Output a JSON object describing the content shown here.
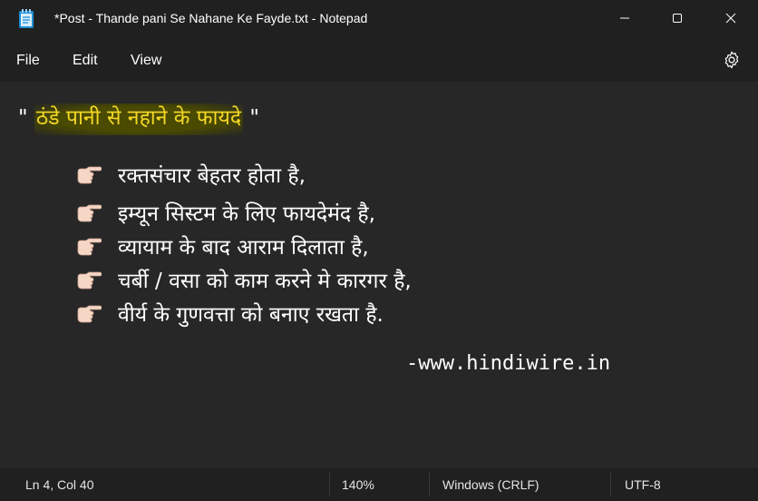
{
  "window": {
    "title": "*Post - Thande pani Se Nahane Ke Fayde.txt - Notepad"
  },
  "menu": {
    "file": "File",
    "edit": "Edit",
    "view": "View"
  },
  "document": {
    "quote_open": "\"",
    "heading": "ठंडे पानी से नहाने के फायदे",
    "quote_close": "\"",
    "bullets": [
      "रक्तसंचार बेहतर होता है,",
      "इम्यून सिस्टम के लिए फायदेमंद है,",
      "व्यायाम के बाद आराम दिलाता है,",
      "चर्बी /  वसा को काम करने मे कारगर है,",
      "वीर्य के गुणवत्ता को बनाए रखता है."
    ],
    "credit": "-www.hindiwire.in"
  },
  "status": {
    "position": "Ln 4, Col 40",
    "zoom": "140%",
    "line_ending": "Windows (CRLF)",
    "encoding": "UTF-8"
  },
  "colors": {
    "background": "#202020",
    "editor": "#272727",
    "highlight_text": "#f4d826",
    "highlight_bg": "#4a4a00"
  },
  "icons": {
    "app": "notepad-icon",
    "minimize": "minimize-icon",
    "maximize": "maximize-icon",
    "close": "close-icon",
    "settings": "gear-icon",
    "bullet": "backhand-pointing-right-icon"
  }
}
